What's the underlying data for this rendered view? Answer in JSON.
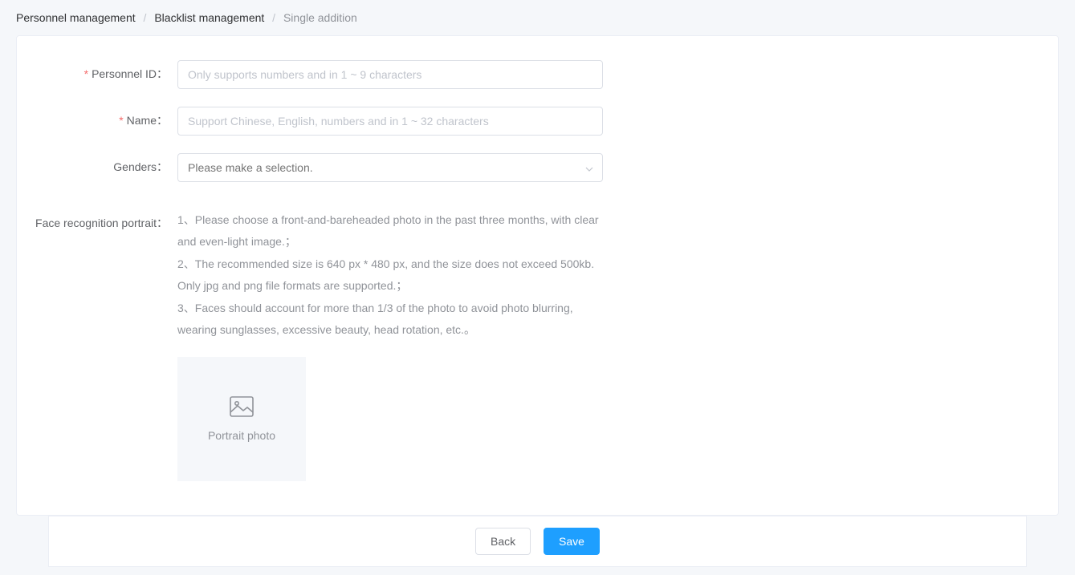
{
  "breadcrumb": {
    "item1": "Personnel management",
    "item2": "Blacklist management",
    "item3": "Single addition",
    "separator": "/"
  },
  "form": {
    "personnel_id": {
      "label": "Personnel ID：",
      "placeholder": "Only supports numbers and in 1 ~ 9 characters",
      "required_mark": "*"
    },
    "name": {
      "label": "Name：",
      "placeholder": "Support Chinese, English, numbers and in 1 ~ 32 characters",
      "required_mark": "*"
    },
    "genders": {
      "label": "Genders：",
      "placeholder": "Please make a selection."
    },
    "portrait": {
      "label": "Face recognition portrait：",
      "instructions": {
        "line1": "1、Please choose a front-and-bareheaded photo in the past three months, with clear and even-light image.；",
        "line2": "2、The recommended size is 640 px * 480 px, and the size does not exceed 500kb. Only jpg and png file formats are supported.；",
        "line3": "3、Faces should account for more than 1/3 of the photo to avoid photo blurring, wearing sunglasses, excessive beauty, head rotation, etc.。"
      },
      "upload_label": "Portrait photo"
    }
  },
  "footer": {
    "back": "Back",
    "save": "Save"
  }
}
